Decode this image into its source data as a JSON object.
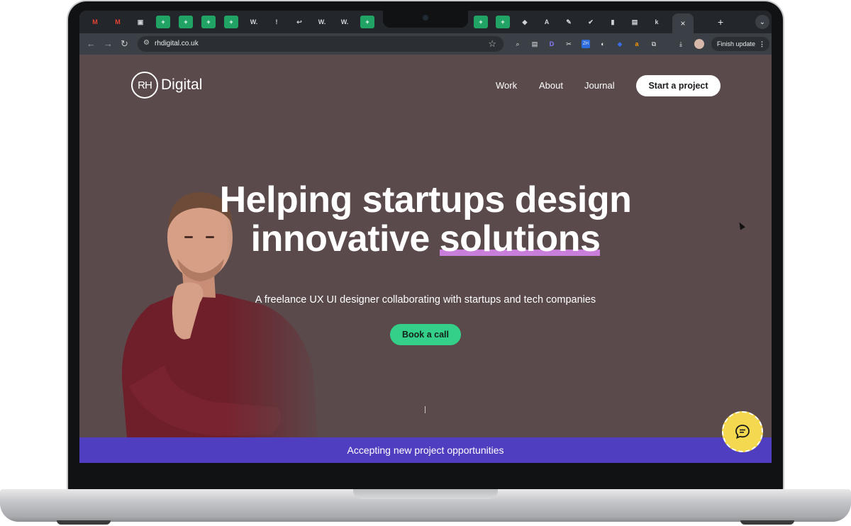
{
  "browser": {
    "tabs": [
      {
        "icon": "gmail-icon",
        "glyph": "M"
      },
      {
        "icon": "gmail-icon",
        "glyph": "M"
      },
      {
        "icon": "docs-icon",
        "glyph": "▣"
      },
      {
        "icon": "sheets-icon",
        "glyph": "+"
      },
      {
        "icon": "sheets-icon",
        "glyph": "+"
      },
      {
        "icon": "sheets-icon",
        "glyph": "+"
      },
      {
        "icon": "sheets-icon",
        "glyph": "+"
      },
      {
        "icon": "word-icon",
        "glyph": "W."
      },
      {
        "icon": "info-icon",
        "glyph": "!"
      },
      {
        "icon": "back-arrow-icon",
        "glyph": "↩"
      },
      {
        "icon": "word-icon",
        "glyph": "W."
      },
      {
        "icon": "word-icon",
        "glyph": "W."
      },
      {
        "icon": "sheets-icon",
        "glyph": "+"
      }
    ],
    "tabs_right": [
      {
        "icon": "sheets-icon",
        "glyph": "+"
      },
      {
        "icon": "sheets-icon",
        "glyph": "+"
      },
      {
        "icon": "app-icon",
        "glyph": "◆"
      },
      {
        "icon": "app-icon",
        "glyph": "A"
      },
      {
        "icon": "app-icon",
        "glyph": "✎"
      },
      {
        "icon": "check-icon",
        "glyph": "✔"
      },
      {
        "icon": "analytics-icon",
        "glyph": "▮"
      },
      {
        "icon": "app-icon",
        "glyph": "▤"
      },
      {
        "icon": "app-icon",
        "glyph": "k"
      }
    ],
    "active_tab_close": "×",
    "new_tab": "+",
    "tab_menu": "⌄",
    "url": "rhdigital.co.uk",
    "update_label": "Finish update"
  },
  "site": {
    "logo_mark": "RH",
    "logo_text": "Digital",
    "nav": [
      "Work",
      "About",
      "Journal"
    ],
    "cta_label": "Start a project",
    "hero_line1": "Helping startups design",
    "hero_line2_plain": "innovative ",
    "hero_line2_highlight": "solutions",
    "subheading": "A freelance UX UI designer collaborating with startups and tech companies",
    "book_label": "Book a call",
    "banner_text": "Accepting new project opportunities"
  },
  "colors": {
    "page_bg": "#5b4a4b",
    "banner_bg": "#4f3fc0",
    "book_btn": "#34d08a",
    "highlight": "#c97ed9",
    "chat_btn": "#f4d84f"
  }
}
